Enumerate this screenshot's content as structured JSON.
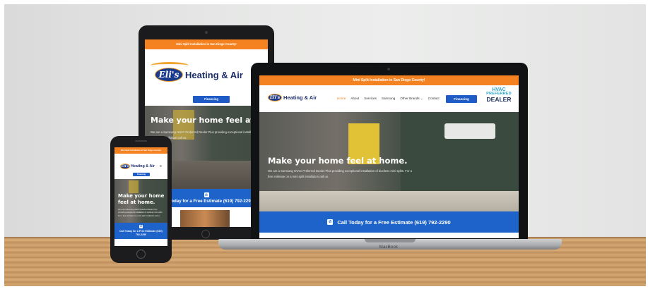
{
  "site": {
    "banner": "Mini Split Installation in San Diego County!",
    "logo": {
      "badge": "Eli's",
      "name": "Heating & Air"
    },
    "nav": [
      "Home",
      "About",
      "Services",
      "Samsung",
      "Other Brands ⌄",
      "Contact"
    ],
    "financing_label": "Financing",
    "hvac_badge": {
      "line1": "HVAC",
      "line2": "PREFERRED",
      "line3": "DEALER"
    },
    "hero": {
      "title": "Make your home feel at home.",
      "title_line1": "Make your home",
      "title_line2": "feel at home.",
      "text": "We are a Samsung HVAC Preferred Dealer Plus providing exceptional installation of ductless mini splits. For a free estimate on a mini split installation call us."
    },
    "cta": "Call Today for a Free Estimate (619) 792-2290",
    "menu_icon_glyph": "≡",
    "phone_icon_glyph": "✆"
  },
  "laptop": {
    "brand": "MacBook"
  },
  "colors": {
    "banner_orange": "#f58220",
    "cta_blue": "#1e63c9",
    "logo_navy": "#1c2e6b",
    "hvac_teal": "#2aa5c9"
  }
}
